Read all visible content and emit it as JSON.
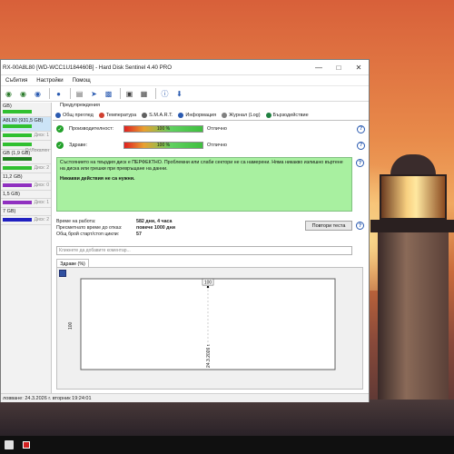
{
  "window": {
    "title": "RX-00A8L80 [WD-WCC1U184460B] - Hard Disk Sentinel 4.40 PRO"
  },
  "menu": [
    "Събития",
    "Настройки",
    "Помощ"
  ],
  "disks": [
    {
      "label": "GB)",
      "sub": "",
      "bar": "green"
    },
    {
      "label": "A8L80 (931,5 GB)",
      "sub": "",
      "bar": "green",
      "selected": true
    },
    {
      "label": "",
      "sub": "Диск: 1",
      "bar": "green"
    },
    {
      "label": "",
      "sub": "D:\\Локален",
      "bar": "green"
    },
    {
      "label": "GB (1,9 GB)",
      "sub": "",
      "bar": "dark"
    },
    {
      "label": "",
      "sub": "Диск: 2",
      "bar": "green"
    },
    {
      "label": "11,2 GB)",
      "sub": "",
      "bar": ""
    },
    {
      "label": "",
      "sub": "Диск: 0",
      "bar": "purple"
    },
    {
      "label": "1,5 GB)",
      "sub": "",
      "bar": ""
    },
    {
      "label": "",
      "sub": "Диск: 1",
      "bar": "purple"
    },
    {
      "label": "7 GB)",
      "sub": "",
      "bar": ""
    },
    {
      "label": "",
      "sub": "Диск: 2",
      "bar": "blue"
    }
  ],
  "tabs_top": "Предупреждения",
  "tabs": [
    {
      "label": "Общ преглед",
      "color": "#2a5ab0"
    },
    {
      "label": "Температура",
      "color": "#d04030"
    },
    {
      "label": "S.M.A.R.T.",
      "color": "#606060"
    },
    {
      "label": "Информация",
      "color": "#2a5ab0"
    },
    {
      "label": "Журнал (Log)",
      "color": "#808080"
    },
    {
      "label": "Бързодействие",
      "color": "#208040"
    }
  ],
  "metrics": [
    {
      "label": "Производителност:",
      "value": "100 %",
      "status": "Отлично"
    },
    {
      "label": "Здраве:",
      "value": "100 %",
      "status": "Отлично"
    }
  ],
  "status_text": "Състоянието на твърдия диск е ПЕРФЕКТНО. Проблемни или слаби сектори не са намерени. Няма никакво излишно въртене на диска или грешки при превръщане на данни.",
  "status_action": "Никакви действия не са нужни.",
  "info": [
    {
      "key": "Време на работа:",
      "value": "582 дни, 4 часа"
    },
    {
      "key": "Пресметнато време до отказ:",
      "value": "повече 1000 дни"
    },
    {
      "key": "Общ брой старт/стоп цикли:",
      "value": "57"
    }
  ],
  "repeat_button": "Повтори теста",
  "comment_placeholder": "Кликнете да добавите коментар...",
  "health_tab": "Здраве (%)",
  "chart_data": {
    "type": "line",
    "x": [
      "24.3.2026 г."
    ],
    "series": [
      {
        "values": [
          100
        ]
      }
    ],
    "ylabel": "100",
    "ylim": [
      0,
      110
    ],
    "data_labels": [
      "100"
    ]
  },
  "statusbar": "ловване: 24.3.2026 г. вторник 19:24:01"
}
